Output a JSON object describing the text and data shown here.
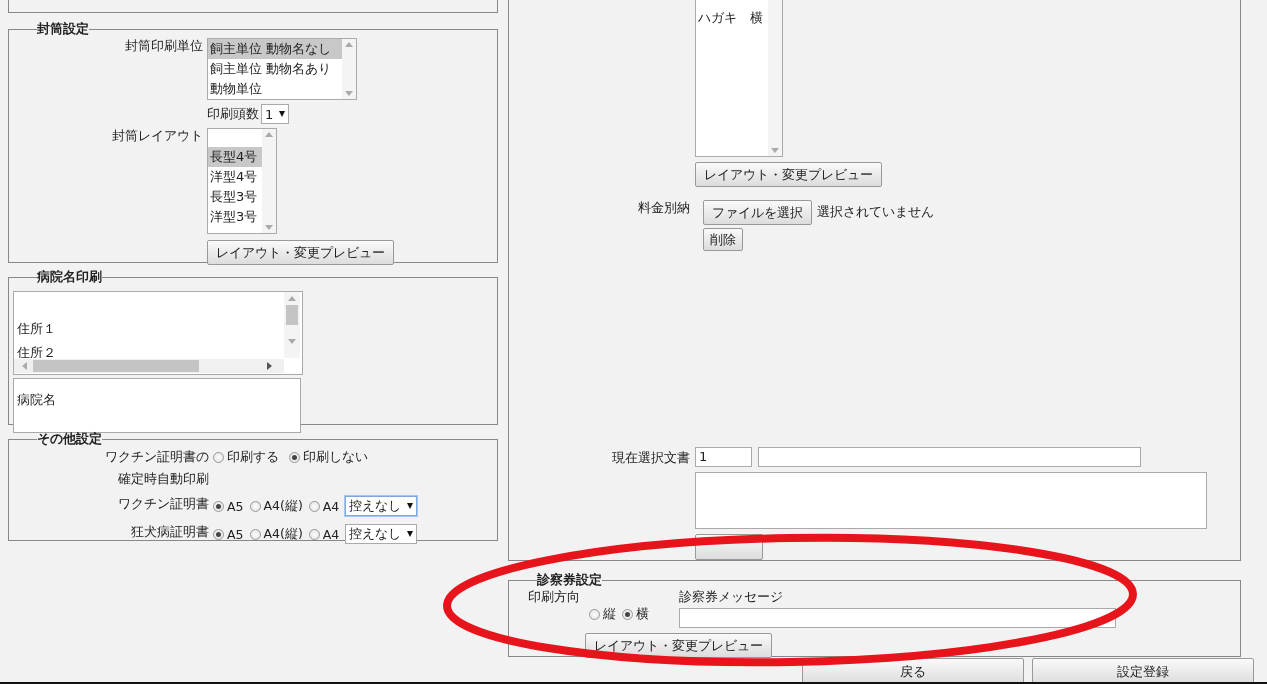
{
  "envelope_settings": {
    "legend": "封筒設定",
    "unit": {
      "label": "封筒印刷単位",
      "options": [
        {
          "label": "飼主単位 動物名なし",
          "selected": true
        },
        {
          "label": "飼主単位 動物名あり",
          "selected": false
        },
        {
          "label": "動物単位",
          "selected": false
        }
      ]
    },
    "count": {
      "label": "印刷頭数",
      "value": "1"
    },
    "layout": {
      "label": "封筒レイアウト",
      "options": [
        {
          "label": "長型4号",
          "selected": true
        },
        {
          "label": "洋型4号",
          "selected": false
        },
        {
          "label": "長型3号",
          "selected": false
        },
        {
          "label": "洋型3号",
          "selected": false
        }
      ]
    },
    "preview_button": "レイアウト・変更プレビュー"
  },
  "hospital_name_print": {
    "legend": "病院名印刷",
    "address_lines": [
      "住所１",
      "住所２"
    ],
    "name_box": "病院名"
  },
  "other_settings": {
    "legend": "その他設定",
    "auto_print": {
      "label_lines": [
        "ワクチン証明書の",
        "確定時自動印刷"
      ],
      "options": [
        {
          "label": "印刷する",
          "selected": false
        },
        {
          "label": "印刷しない",
          "selected": true
        }
      ]
    },
    "certificates": [
      {
        "label": "ワクチン証明書",
        "options": [
          {
            "label": "A5",
            "selected": true
          },
          {
            "label": "A4(縦)",
            "selected": false
          },
          {
            "label": "A4",
            "selected": false
          }
        ],
        "copy": "控えなし",
        "focused": true
      },
      {
        "label": "狂犬病証明書",
        "options": [
          {
            "label": "A5",
            "selected": true
          },
          {
            "label": "A4(縦)",
            "selected": false
          },
          {
            "label": "A4",
            "selected": false
          }
        ],
        "copy": "控えなし",
        "focused": false
      }
    ]
  },
  "postcard": {
    "layout_options": [
      {
        "label": "ハガキ　横",
        "selected": false
      }
    ],
    "preview_button": "レイアウト・変更プレビュー",
    "postage": {
      "label": "料金別納",
      "file_button": "ファイルを選択",
      "file_status": "選択されていません",
      "delete_button": "削除"
    },
    "current_document": {
      "label": "現在選択文書",
      "number": "1"
    }
  },
  "card_settings": {
    "legend": "診察券設定",
    "orientation": {
      "label": "印刷方向",
      "options": [
        {
          "label": "縦",
          "selected": false
        },
        {
          "label": "横",
          "selected": true
        }
      ]
    },
    "message_label": "診察券メッセージ",
    "preview_button": "レイアウト・変更プレビュー"
  },
  "footer_buttons": [
    "戻る",
    "設定登録"
  ],
  "annotation": {
    "kind": "ellipse",
    "color": "#e8141c"
  }
}
